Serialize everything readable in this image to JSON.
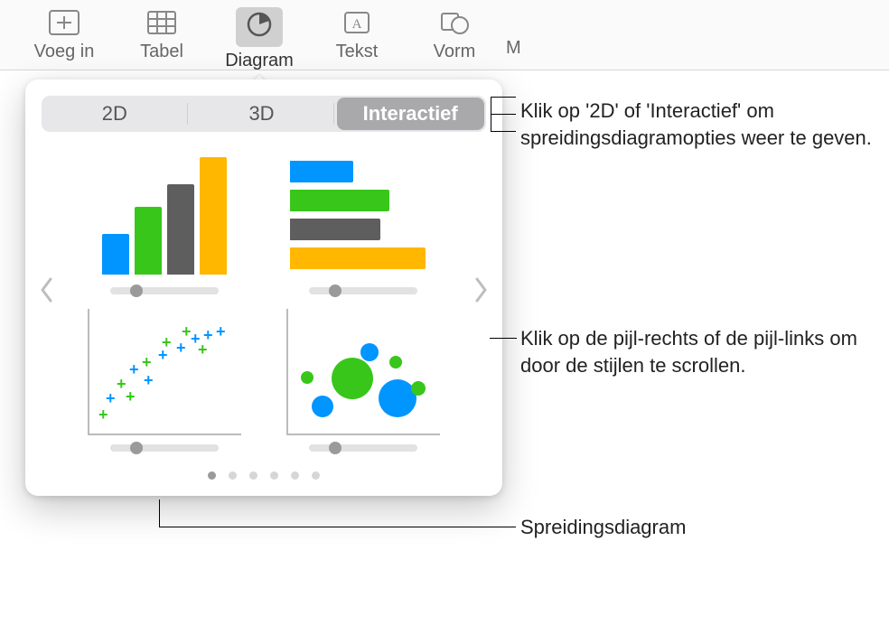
{
  "toolbar": {
    "items": [
      {
        "label": "Voeg in",
        "icon": "insert"
      },
      {
        "label": "Tabel",
        "icon": "table"
      },
      {
        "label": "Diagram",
        "icon": "chart",
        "active": true
      },
      {
        "label": "Tekst",
        "icon": "text"
      },
      {
        "label": "Vorm",
        "icon": "shape"
      },
      {
        "label": "M",
        "icon": "",
        "truncated": true
      }
    ]
  },
  "popover": {
    "tabs": [
      "2D",
      "3D",
      "Interactief"
    ],
    "selected_tab": "Interactief",
    "page_count": 6,
    "current_page": 1,
    "thumbnails": [
      {
        "kind": "vertical-bar",
        "name": "interactive-column-chart"
      },
      {
        "kind": "horizontal-bar",
        "name": "interactive-bar-chart"
      },
      {
        "kind": "scatter",
        "name": "interactive-scatter-chart"
      },
      {
        "kind": "bubble",
        "name": "interactive-bubble-chart"
      }
    ]
  },
  "callouts": {
    "tabs": "Klik op '2D' of 'Interactief' om spreidingsdiagramopties weer te geven.",
    "arrows": "Klik op de pijl-rechts of de pijl-links om door de stijlen te scrollen.",
    "scatter_label": "Spreidingsdiagram"
  }
}
